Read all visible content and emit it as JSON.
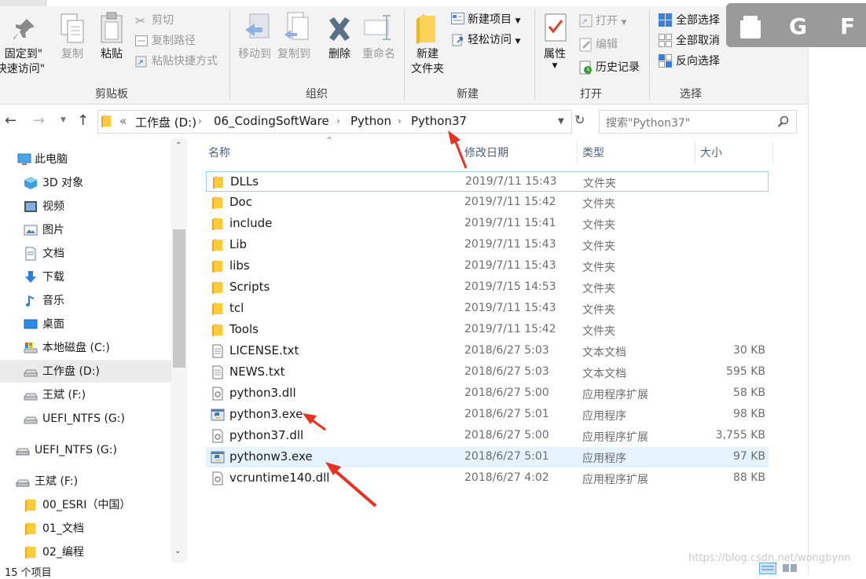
{
  "ribbon": {
    "pin": {
      "line1": "固定到\"",
      "line2": "快速访问\""
    },
    "copy": "复制",
    "paste": "粘贴",
    "cut": "剪切",
    "copy_path": "复制路径",
    "paste_shortcut": "粘贴快捷方式",
    "move_to": "移动到",
    "copy_to": "复制到",
    "delete": "删除",
    "rename": "重命名",
    "new_folder": {
      "line1": "新建",
      "line2": "文件夹"
    },
    "new_item": "新建项目",
    "easy_access": "轻松访问",
    "properties": "属性",
    "open": "打开",
    "edit": "编辑",
    "history": "历史记录",
    "select_all": "全部选择",
    "select_none": "全部取消",
    "invert_selection": "反向选择",
    "groups": {
      "clipboard": "剪贴板",
      "organize": "组织",
      "new": "新建",
      "open": "打开",
      "select": "选择"
    }
  },
  "overlay_letters": [
    "G",
    "F"
  ],
  "address": {
    "chevron": "«",
    "crumbs": [
      "工作盘 (D:)",
      "06_CodingSoftWare",
      "Python",
      "Python37"
    ],
    "search_placeholder": "搜索\"Python37\""
  },
  "nav": [
    {
      "label": "此电脑",
      "icon": "computer-icon"
    },
    {
      "label": "3D 对象",
      "icon": "3d-objects-icon"
    },
    {
      "label": "视频",
      "icon": "video-icon"
    },
    {
      "label": "图片",
      "icon": "pictures-icon"
    },
    {
      "label": "文档",
      "icon": "documents-icon"
    },
    {
      "label": "下载",
      "icon": "download-icon"
    },
    {
      "label": "音乐",
      "icon": "music-icon"
    },
    {
      "label": "桌面",
      "icon": "desktop-icon"
    },
    {
      "label": "本地磁盘 (C:)",
      "icon": "drive-c-icon"
    },
    {
      "label": "工作盘 (D:)",
      "icon": "drive-icon"
    },
    {
      "label": "王斌 (F:)",
      "icon": "drive-icon"
    },
    {
      "label": "UEFI_NTFS (G:)",
      "icon": "drive-icon"
    },
    {
      "label": "UEFI_NTFS (G:)",
      "icon": "usb-drive-icon"
    },
    {
      "label": "王斌 (F:)",
      "icon": "usb-drive-icon"
    },
    {
      "label": "00_ESRI（中国）",
      "icon": "folder-icon"
    },
    {
      "label": "01_文档",
      "icon": "folder-icon"
    },
    {
      "label": "02_编程",
      "icon": "folder-icon"
    }
  ],
  "columns": {
    "name": "名称",
    "date": "修改日期",
    "type": "类型",
    "size": "大小"
  },
  "files": [
    {
      "name": "DLLs",
      "date": "2019/7/11 15:43",
      "type": "文件夹",
      "size": "",
      "icon": "folder-icon"
    },
    {
      "name": "Doc",
      "date": "2019/7/11 15:42",
      "type": "文件夹",
      "size": "",
      "icon": "folder-icon"
    },
    {
      "name": "include",
      "date": "2019/7/11 15:41",
      "type": "文件夹",
      "size": "",
      "icon": "folder-icon"
    },
    {
      "name": "Lib",
      "date": "2019/7/11 15:43",
      "type": "文件夹",
      "size": "",
      "icon": "folder-icon"
    },
    {
      "name": "libs",
      "date": "2019/7/11 15:43",
      "type": "文件夹",
      "size": "",
      "icon": "folder-icon"
    },
    {
      "name": "Scripts",
      "date": "2019/7/15 14:53",
      "type": "文件夹",
      "size": "",
      "icon": "folder-icon"
    },
    {
      "name": "tcl",
      "date": "2019/7/11 15:43",
      "type": "文件夹",
      "size": "",
      "icon": "folder-icon"
    },
    {
      "name": "Tools",
      "date": "2019/7/11 15:42",
      "type": "文件夹",
      "size": "",
      "icon": "folder-icon"
    },
    {
      "name": "LICENSE.txt",
      "date": "2018/6/27 5:03",
      "type": "文本文档",
      "size": "30 KB",
      "icon": "text-file-icon"
    },
    {
      "name": "NEWS.txt",
      "date": "2018/6/27 5:03",
      "type": "文本文档",
      "size": "595 KB",
      "icon": "text-file-icon"
    },
    {
      "name": "python3.dll",
      "date": "2018/6/27 5:00",
      "type": "应用程序扩展",
      "size": "58 KB",
      "icon": "dll-file-icon"
    },
    {
      "name": "python3.exe",
      "date": "2018/6/27 5:01",
      "type": "应用程序",
      "size": "98 KB",
      "icon": "python-exe-icon"
    },
    {
      "name": "python37.dll",
      "date": "2018/6/27 5:00",
      "type": "应用程序扩展",
      "size": "3,755 KB",
      "icon": "dll-file-icon"
    },
    {
      "name": "pythonw3.exe",
      "date": "2018/6/27 5:01",
      "type": "应用程序",
      "size": "97 KB",
      "icon": "python-exe-icon"
    },
    {
      "name": "vcruntime140.dll",
      "date": "2018/6/27 4:02",
      "type": "应用程序扩展",
      "size": "88 KB",
      "icon": "dll-file-icon"
    }
  ],
  "status": {
    "item_count": "15 个项目"
  },
  "watermark": "https://blog.csdn.net/wongbynn",
  "colors": {
    "accent": "#0078d7",
    "arrow": "#e8321f",
    "folder": "#ffcb3d",
    "hover": "#e5f3ff"
  }
}
